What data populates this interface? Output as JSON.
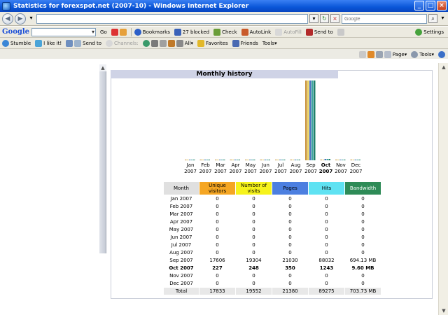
{
  "window": {
    "title": "Statistics for forexspot.net (2007-10) - Windows Internet Explorer"
  },
  "address_bar": {
    "url": "",
    "search_placeholder": "Google"
  },
  "google_toolbar": {
    "logo": "Google",
    "go": "Go",
    "bookmarks": "Bookmarks",
    "blocked": "27 blocked",
    "check": "Check",
    "autolink": "AutoLink",
    "autofill": "AutoFill",
    "sendto": "Send to",
    "settings": "Settings"
  },
  "stumble_toolbar": {
    "stumble": "Stumble",
    "like": "I like it!",
    "sendto": "Send to",
    "channels": "Channels:",
    "all": "All",
    "favorites": "Favorites",
    "friends": "Friends",
    "tools": "Tools"
  },
  "command_bar": {
    "page": "Page",
    "tools": "Tools"
  },
  "section_title": "Monthly history",
  "colors": {
    "unique": "#f5a623",
    "visits": "#f6f31c",
    "pages": "#4c7fe0",
    "hits": "#5fe2f2",
    "bandwidth": "#2e8b57",
    "header_bg": "#cfd3e6"
  },
  "chart_data": {
    "type": "bar",
    "categories": [
      "Jan 2007",
      "Feb 2007",
      "Mar 2007",
      "Apr 2007",
      "May 2007",
      "Jun 2007",
      "Jul 2007",
      "Aug 2007",
      "Sep 2007",
      "Oct 2007",
      "Nov 2007",
      "Dec 2007"
    ],
    "month_labels": [
      {
        "m": "Jan",
        "y": "2007"
      },
      {
        "m": "Feb",
        "y": "2007"
      },
      {
        "m": "Mar",
        "y": "2007"
      },
      {
        "m": "Apr",
        "y": "2007"
      },
      {
        "m": "May",
        "y": "2007"
      },
      {
        "m": "Jun",
        "y": "2007"
      },
      {
        "m": "Jul",
        "y": "2007"
      },
      {
        "m": "Aug",
        "y": "2007"
      },
      {
        "m": "Sep",
        "y": "2007"
      },
      {
        "m": "Oct",
        "y": "2007"
      },
      {
        "m": "Nov",
        "y": "2007"
      },
      {
        "m": "Dec",
        "y": "2007"
      }
    ],
    "current_index": 9,
    "series": [
      {
        "name": "Unique visitors",
        "values": [
          0,
          0,
          0,
          0,
          0,
          0,
          0,
          0,
          17606,
          227,
          0,
          0
        ]
      },
      {
        "name": "Number of visits",
        "values": [
          0,
          0,
          0,
          0,
          0,
          0,
          0,
          0,
          19304,
          248,
          0,
          0
        ]
      },
      {
        "name": "Pages",
        "values": [
          0,
          0,
          0,
          0,
          0,
          0,
          0,
          0,
          21030,
          350,
          0,
          0
        ]
      },
      {
        "name": "Hits",
        "values": [
          0,
          0,
          0,
          0,
          0,
          0,
          0,
          0,
          88032,
          1243,
          0,
          0
        ]
      },
      {
        "name": "Bandwidth",
        "values": [
          0,
          0,
          0,
          0,
          0,
          0,
          0,
          0,
          694.13,
          9.6,
          0,
          0
        ]
      }
    ]
  },
  "table": {
    "headers": [
      "Month",
      "Unique visitors",
      "Number of visits",
      "Pages",
      "Hits",
      "Bandwidth"
    ],
    "rows": [
      [
        "Jan 2007",
        "0",
        "0",
        "0",
        "0",
        "0"
      ],
      [
        "Feb 2007",
        "0",
        "0",
        "0",
        "0",
        "0"
      ],
      [
        "Mar 2007",
        "0",
        "0",
        "0",
        "0",
        "0"
      ],
      [
        "Apr 2007",
        "0",
        "0",
        "0",
        "0",
        "0"
      ],
      [
        "May 2007",
        "0",
        "0",
        "0",
        "0",
        "0"
      ],
      [
        "Jun 2007",
        "0",
        "0",
        "0",
        "0",
        "0"
      ],
      [
        "Jul 2007",
        "0",
        "0",
        "0",
        "0",
        "0"
      ],
      [
        "Aug 2007",
        "0",
        "0",
        "0",
        "0",
        "0"
      ],
      [
        "Sep 2007",
        "17606",
        "19304",
        "21030",
        "88032",
        "694.13 MB"
      ],
      [
        "Oct 2007",
        "227",
        "248",
        "350",
        "1243",
        "9.60 MB"
      ],
      [
        "Nov 2007",
        "0",
        "0",
        "0",
        "0",
        "0"
      ],
      [
        "Dec 2007",
        "0",
        "0",
        "0",
        "0",
        "0"
      ]
    ],
    "total": [
      "Total",
      "17833",
      "19552",
      "21380",
      "89275",
      "703.73 MB"
    ]
  }
}
